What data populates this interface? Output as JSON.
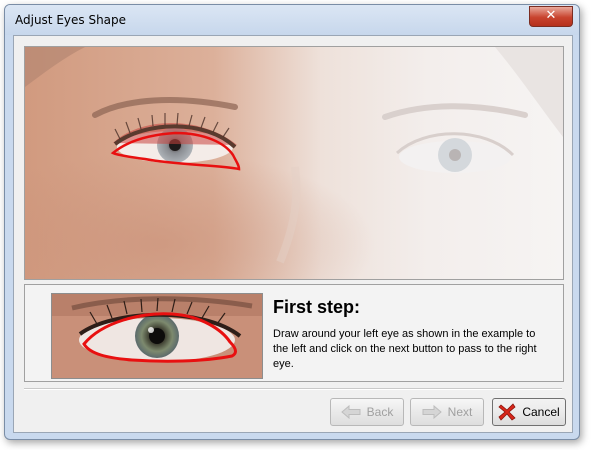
{
  "window": {
    "title": "Adjust Eyes Shape",
    "close_glyph": "✕"
  },
  "instructions": {
    "heading": "First step:",
    "text": "Draw around your left eye as shown in the example to the left and click on the next button to pass to the right eye."
  },
  "buttons": {
    "back": {
      "label": "Back",
      "enabled": false,
      "icon": "arrow-left-icon"
    },
    "next": {
      "label": "Next",
      "enabled": false,
      "icon": "arrow-right-icon"
    },
    "cancel": {
      "label": "Cancel",
      "enabled": true,
      "icon": "red-x-icon"
    }
  },
  "colors": {
    "eye_outline": "#e81010",
    "cancel_icon": "#d8261a"
  }
}
